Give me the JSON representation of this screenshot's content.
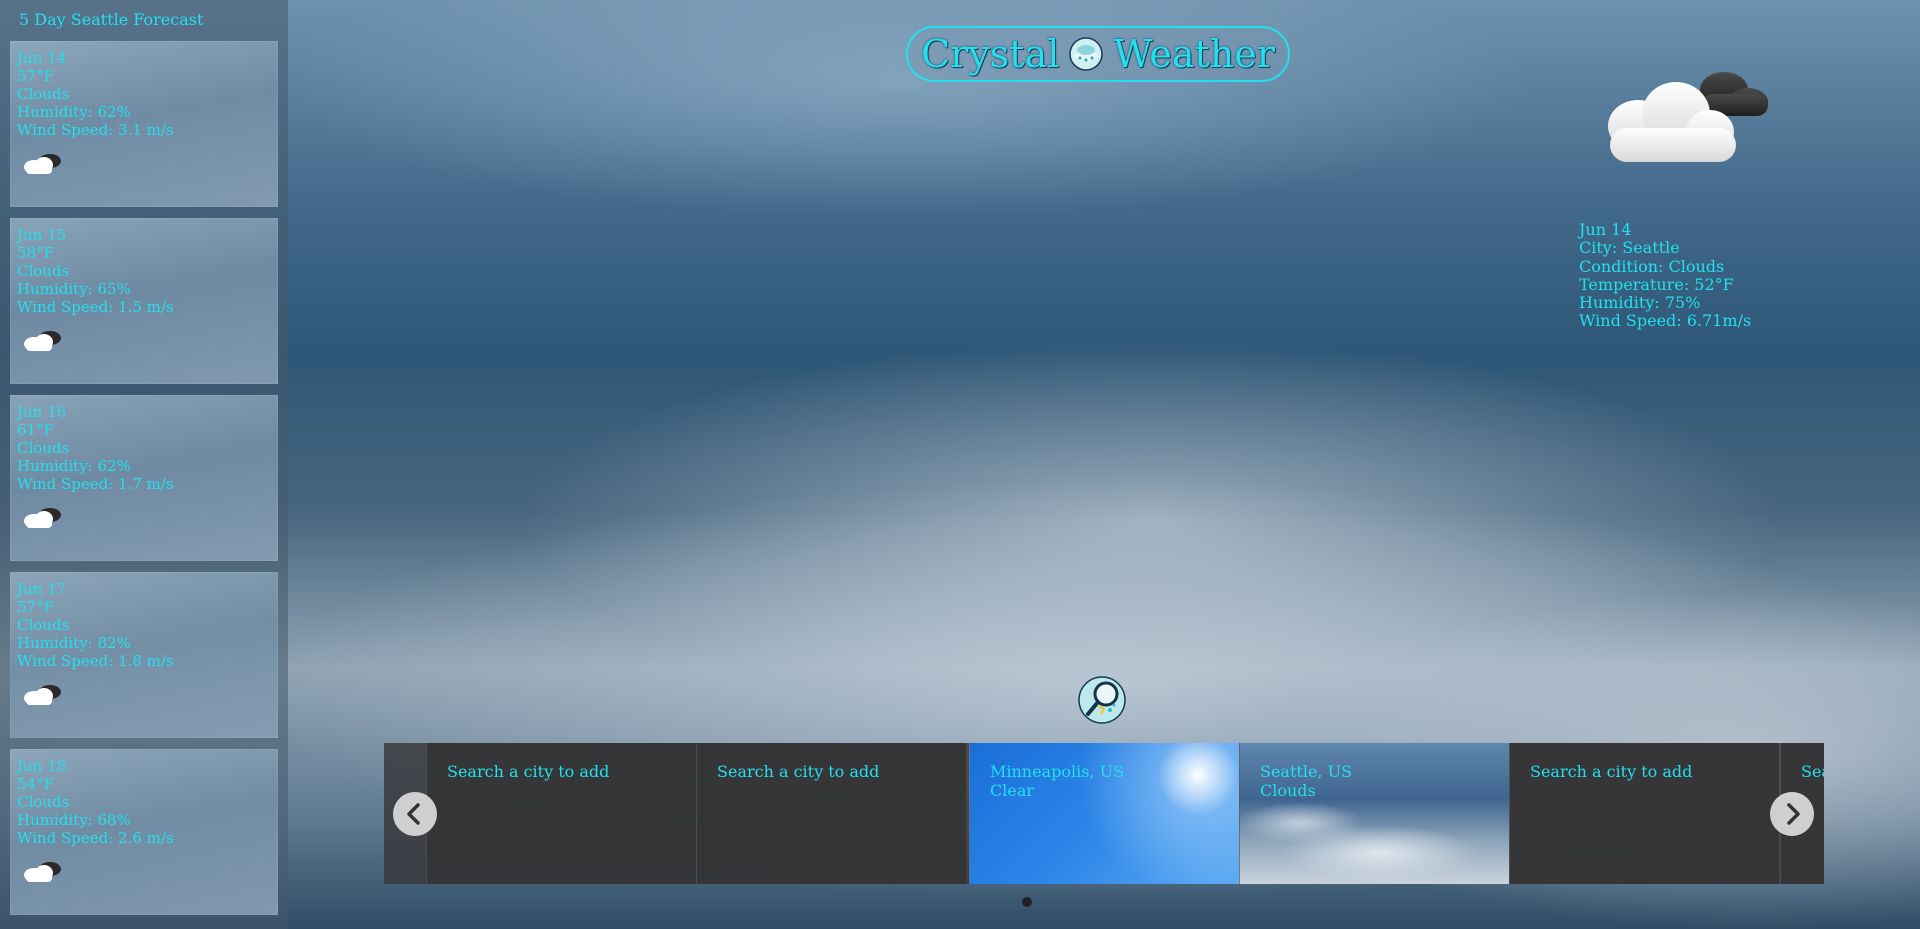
{
  "sidebar": {
    "title": "5 Day Seattle Forecast",
    "days": [
      {
        "date": "Jun 14",
        "temp": "57°F",
        "condition": "Clouds",
        "humidity": "Humidity: 62%",
        "wind": "Wind Speed: 3.1 m/s",
        "icon": "cloud-icon"
      },
      {
        "date": "Jun 15",
        "temp": "58°F",
        "condition": "Clouds",
        "humidity": "Humidity: 65%",
        "wind": "Wind Speed: 1.5 m/s",
        "icon": "cloud-icon"
      },
      {
        "date": "Jun 16",
        "temp": "61°F",
        "condition": "Clouds",
        "humidity": "Humidity: 62%",
        "wind": "Wind Speed: 1.7 m/s",
        "icon": "cloud-icon"
      },
      {
        "date": "Jun 17",
        "temp": "57°F",
        "condition": "Clouds",
        "humidity": "Humidity: 82%",
        "wind": "Wind Speed: 1.8 m/s",
        "icon": "cloud-icon"
      },
      {
        "date": "Jun 18",
        "temp": "54°F",
        "condition": "Clouds",
        "humidity": "Humidity: 68%",
        "wind": "Wind Speed: 2.6 m/s",
        "icon": "cloud-icon"
      }
    ]
  },
  "header": {
    "title_left": "Crystal",
    "title_right": "Weather",
    "logo_icon": "crystal-ball-icon"
  },
  "current": {
    "icon": "cloud-icon",
    "date": "Jun 14",
    "city": "City: Seattle",
    "condition": "Condition: Clouds",
    "temperature": "Temperature: 52°F",
    "humidity": "Humidity: 75%",
    "wind": "Wind Speed: 6.71m/s"
  },
  "search": {
    "icon": "search-icon"
  },
  "carousel": {
    "slides": [
      {
        "line1": "Search a city to add",
        "line2": ""
      },
      {
        "line1": "Search a city to add",
        "line2": ""
      },
      {
        "line1": "Minneapolis, US",
        "line2": "Clear"
      },
      {
        "line1": "Seattle, US",
        "line2": "Clouds"
      },
      {
        "line1": "Search a city to add",
        "line2": ""
      },
      {
        "line1": "Search a city to add",
        "line2": ""
      }
    ],
    "prev_icon": "chevron-left-icon",
    "next_icon": "chevron-right-icon"
  },
  "colors": {
    "accent": "#22e0ee"
  }
}
